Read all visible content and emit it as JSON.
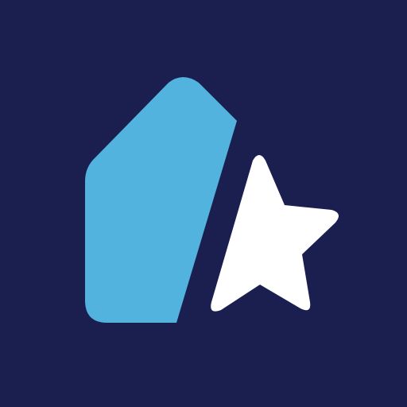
{
  "icon": {
    "name": "home-star-logo",
    "colors": {
      "background": "#1b1f50",
      "house": "#52b3de",
      "star": "#ffffff"
    }
  }
}
